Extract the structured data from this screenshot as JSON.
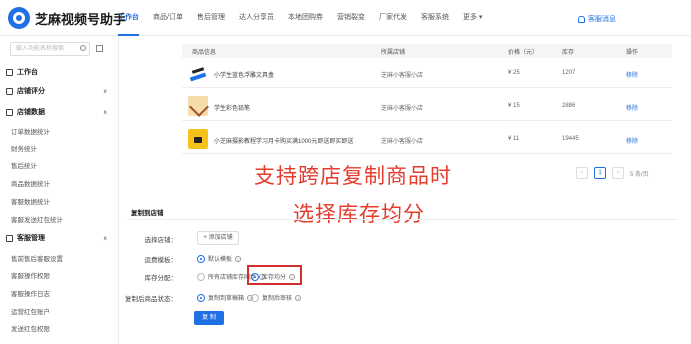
{
  "app": {
    "title": "芝麻视频号助手"
  },
  "topnav": [
    "工作台",
    "商品/订单",
    "售后管理",
    "达人分享员",
    "本地团购券",
    "营销裂变",
    "厂家代发",
    "客服系统",
    "更多"
  ],
  "service_label": "客服消息",
  "sidebar": {
    "search_placeholder": "输入功能名称搜索",
    "groups": [
      {
        "label": "工作台"
      },
      {
        "label": "店铺评分"
      },
      {
        "label": "店铺数据"
      },
      {
        "label": "客服管理"
      }
    ],
    "items_data": [
      "订单数据统计",
      "财务统计",
      "售后统计",
      "商品数据统计",
      "客服数据统计",
      "客服发送红包统计"
    ],
    "items_service": [
      "售前售后客服设置",
      "客服操作权限",
      "客服操作日志",
      "运营红包账户",
      "发送红包权限"
    ]
  },
  "table": {
    "headers": [
      "商品信息",
      "所属店铺",
      "价格（元）",
      "库存",
      "操作"
    ],
    "rows": [
      {
        "name": "小学生蓝色浮雕文具盒",
        "store": "芝麻小客服小店",
        "price": "¥ 25",
        "stock": "1207",
        "op": "移除"
      },
      {
        "name": "学生彩色铅笔",
        "store": "芝麻小客服小店",
        "price": "¥ 15",
        "stock": "2886",
        "op": "移除"
      },
      {
        "name": "小芝麻摄影教程学习月卡购买满1000元即送即买即送",
        "store": "芝麻小客服小店",
        "price": "¥ 11",
        "stock": "19445",
        "op": "移除"
      }
    ]
  },
  "pager": {
    "current": "1",
    "page_size": "5 条/页"
  },
  "overlay": {
    "line1": "支持跨店复制商品时",
    "line2": "选择库存均分"
  },
  "form": {
    "section_title": "复制到店铺",
    "store_label": "选择店铺：",
    "add_store": "+ 添加店铺",
    "shipping_label": "运费模板：",
    "shipping_option": "默认模板",
    "stock_label": "库存分配：",
    "stock_opt1": "所有店铺库存同步",
    "stock_opt2": "库存均分",
    "status_label": "复制后商品状态：",
    "status_opt1": "复制到草稿箱",
    "status_opt2": "复制后审核",
    "copy_button": "复 制"
  },
  "colors": {
    "accent": "#1f6fe5",
    "highlight": "#d32f2f",
    "overlay_text": "#e43b2c"
  }
}
